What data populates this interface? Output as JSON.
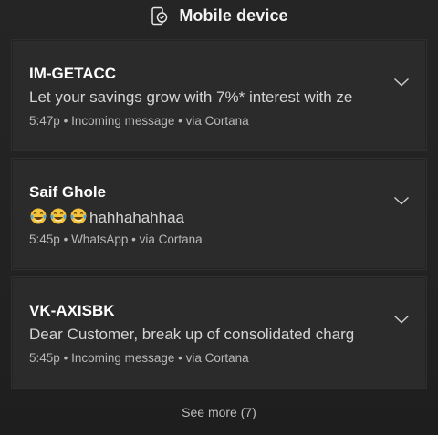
{
  "header": {
    "title": "Mobile device",
    "icon": "phone-link-icon"
  },
  "notifications": [
    {
      "sender": "IM-GETACC",
      "body": "Let your savings grow with 7%* interest with ze",
      "time": "5:47p",
      "source": "Incoming message",
      "via": "via Cortana",
      "separator": "•"
    },
    {
      "sender": "Saif Ghole",
      "body_emoji_count": 3,
      "body_emoji": "tears-of-joy-emoji",
      "body": "hahhahahhaa",
      "time": "5:45p",
      "source": "WhatsApp",
      "via": "via Cortana",
      "separator": "•"
    },
    {
      "sender": "VK-AXISBK",
      "body": "Dear Customer, break up of consolidated charg",
      "time": "5:45p",
      "source": "Incoming message",
      "via": "via Cortana",
      "separator": "•"
    }
  ],
  "footer": {
    "see_more": "See more (7)"
  },
  "colors": {
    "background": "#222222",
    "card": "#2b2b2b",
    "text_primary": "#ffffff",
    "text_secondary": "#b8b8b8",
    "emoji_face": "#f5c33b"
  }
}
